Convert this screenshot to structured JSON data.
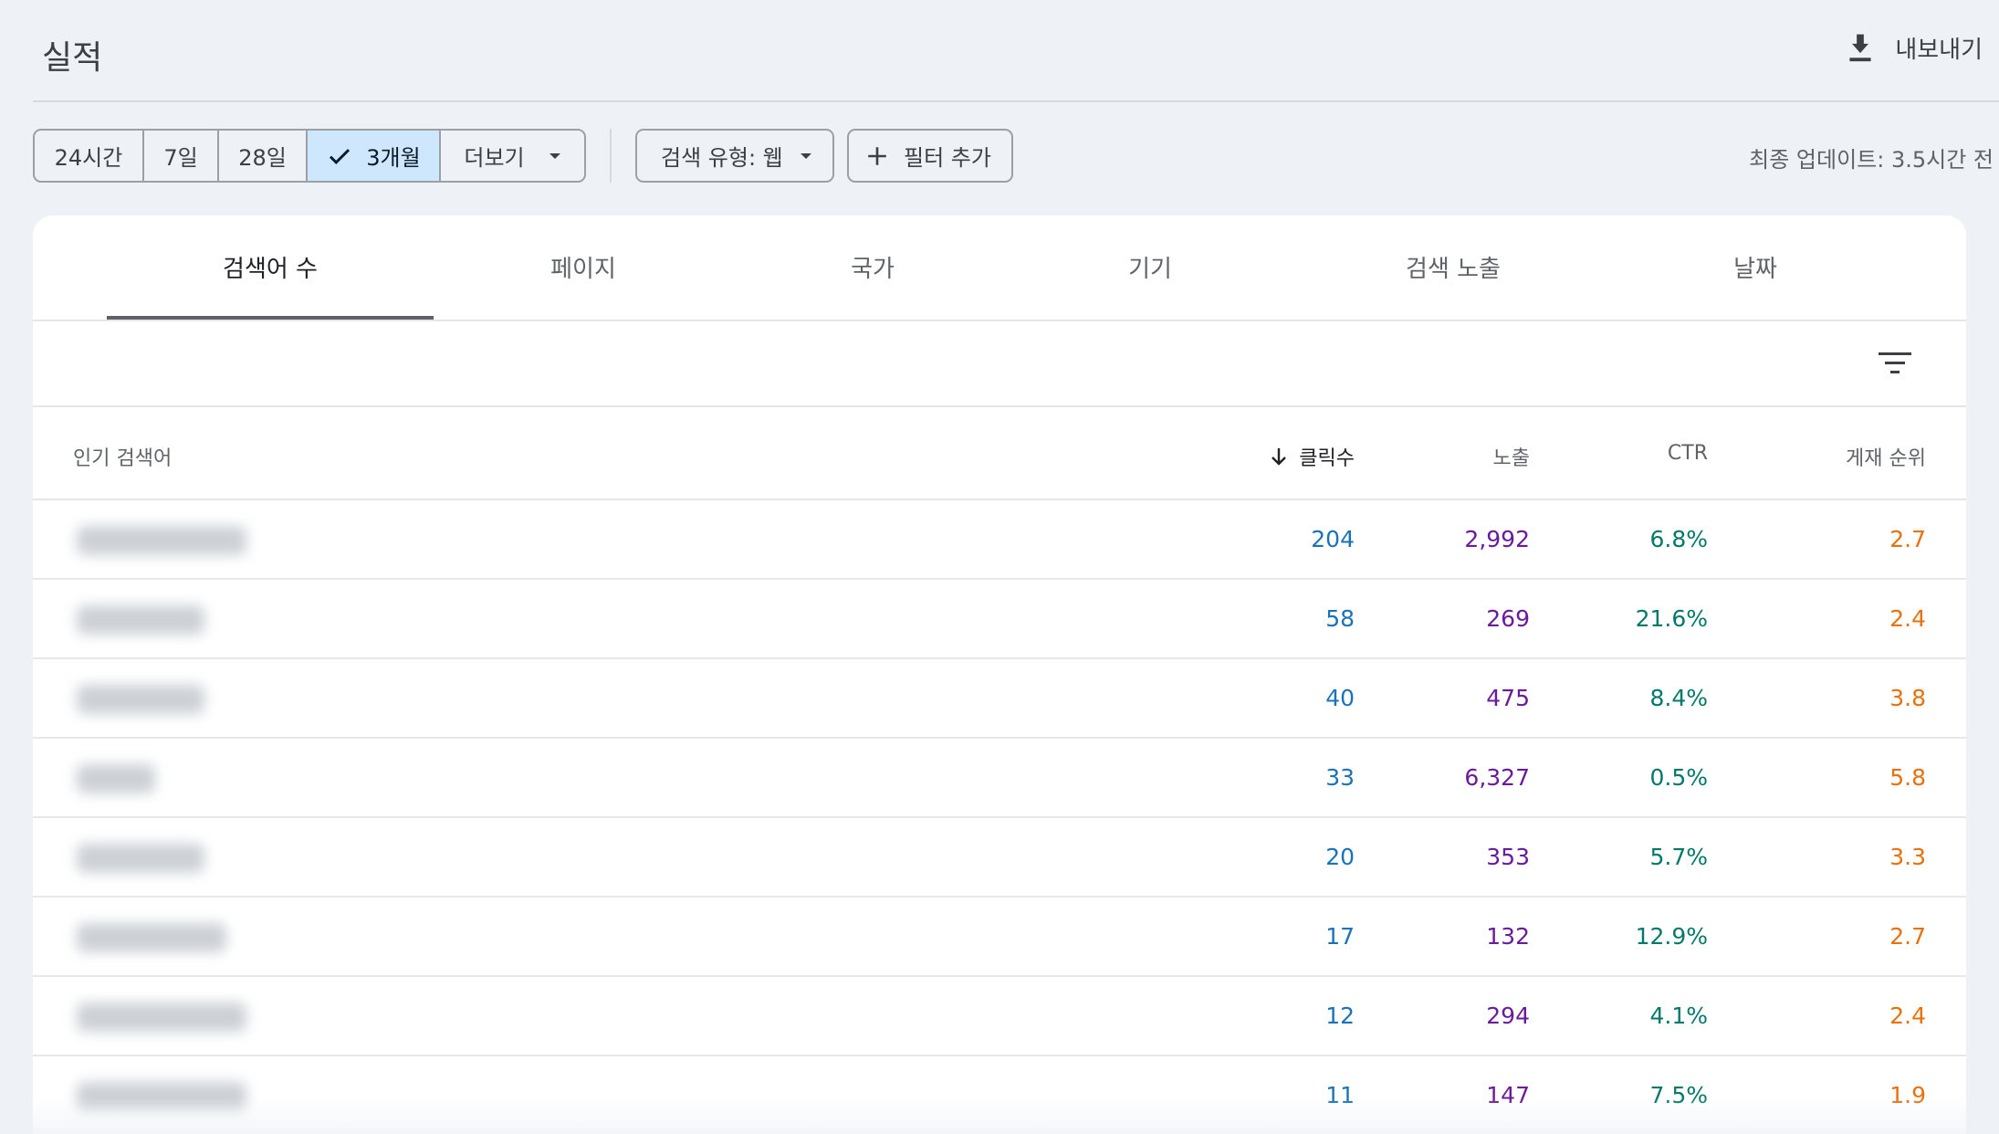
{
  "header": {
    "title": "실적",
    "export_label": "내보내기"
  },
  "toolbar": {
    "ranges": [
      {
        "label": "24시간",
        "active": false
      },
      {
        "label": "7일",
        "active": false
      },
      {
        "label": "28일",
        "active": false
      },
      {
        "label": "3개월",
        "active": true
      },
      {
        "label": "더보기",
        "active": false
      }
    ],
    "search_type": "검색 유형: 웹",
    "add_filter": "필터 추가",
    "updated": "최종 업데이트: 3.5시간 전"
  },
  "tabs": [
    {
      "label": "검색어 수",
      "active": true
    },
    {
      "label": "페이지",
      "active": false
    },
    {
      "label": "국가",
      "active": false
    },
    {
      "label": "기기",
      "active": false
    },
    {
      "label": "검색 노출",
      "active": false
    },
    {
      "label": "날짜",
      "active": false
    }
  ],
  "table": {
    "columns": {
      "query": "인기 검색어",
      "clicks": "클릭수",
      "impressions": "노출",
      "ctr": "CTR",
      "position": "게재 순위"
    },
    "rows": [
      {
        "clicks": "204",
        "impressions": "2,992",
        "ctr": "6.8%",
        "position": "2.7"
      },
      {
        "clicks": "58",
        "impressions": "269",
        "ctr": "21.6%",
        "position": "2.4"
      },
      {
        "clicks": "40",
        "impressions": "475",
        "ctr": "8.4%",
        "position": "3.8"
      },
      {
        "clicks": "33",
        "impressions": "6,327",
        "ctr": "0.5%",
        "position": "5.8"
      },
      {
        "clicks": "20",
        "impressions": "353",
        "ctr": "5.7%",
        "position": "3.3"
      },
      {
        "clicks": "17",
        "impressions": "132",
        "ctr": "12.9%",
        "position": "2.7"
      },
      {
        "clicks": "12",
        "impressions": "294",
        "ctr": "4.1%",
        "position": "2.4"
      },
      {
        "clicks": "11",
        "impressions": "147",
        "ctr": "7.5%",
        "position": "1.9"
      }
    ]
  },
  "colors": {
    "clicks": "#1a73b8",
    "impressions": "#6a1b9a",
    "ctr": "#00796b",
    "position": "#e8710a",
    "active_segment": "#cfe7fc"
  }
}
